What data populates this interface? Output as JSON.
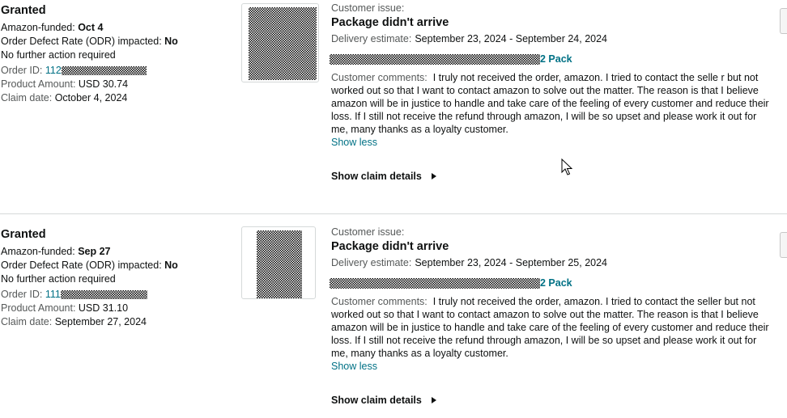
{
  "claims": [
    {
      "status": "Granted",
      "funded_label": "Amazon-funded: ",
      "funded_value": "Oct 4",
      "odr_label": "Order Defect Rate (ODR) impacted: ",
      "odr_value": "No",
      "action": "No further action required",
      "order_label": "Order ID: ",
      "order_prefix": "112",
      "amount_label": "Product Amount: ",
      "amount_value": "USD 30.74",
      "claim_date_label": "Claim date: ",
      "claim_date_value": "October 4, 2024",
      "issue_label": "Customer issue:",
      "issue_title": "Package didn't arrive",
      "delivery_label": "Delivery estimate:",
      "delivery_value": "September 23, 2024 - September 24, 2024",
      "product_suffix": "2 Pack",
      "comments_label": "Customer comments:",
      "comments_text": "I truly not received the order, amazon. I tried to contact the selle r but not worked out so that I want to contact amazon to solve out the matter. The reason is that I believe amazon will be in justice to handle and take care of the feeling of every customer and reduce their loss. If I still not receive the refund through amazon, I will be so upset and please work it out for me, many thanks as a loyalty customer.",
      "show_less": "Show less",
      "show_details": "Show claim details"
    },
    {
      "status": "Granted",
      "funded_label": "Amazon-funded: ",
      "funded_value": "Sep 27",
      "odr_label": "Order Defect Rate (ODR) impacted: ",
      "odr_value": "No",
      "action": "No further action required",
      "order_label": "Order ID: ",
      "order_prefix": "111",
      "amount_label": "Product Amount: ",
      "amount_value": "USD 31.10",
      "claim_date_label": "Claim date: ",
      "claim_date_value": "September 27, 2024",
      "issue_label": "Customer issue:",
      "issue_title": "Package didn't arrive",
      "delivery_label": "Delivery estimate:",
      "delivery_value": "September 23, 2024 - September 25, 2024",
      "product_suffix": "2 Pack",
      "comments_label": "Customer comments:",
      "comments_text": "I truly not received the order, amazon. I tried to contact the seller but not worked out so that I want to contact amazon to solve out the matter. The reason is that I believe amazon will be in justice to handle and take care of the feeling of every customer and reduce their loss. If I still not receive the refund through amazon, I will be so upset and please work it out for me, many thanks as a loyalty customer.",
      "show_less": "Show less",
      "show_details": "Show claim details"
    }
  ],
  "icons": {
    "expand": "triangle-right-icon",
    "cursor": "mouse-pointer-icon"
  },
  "colors": {
    "link": "#007185",
    "text": "#0f1111",
    "muted": "#565959",
    "divider": "#d5d9d9"
  }
}
